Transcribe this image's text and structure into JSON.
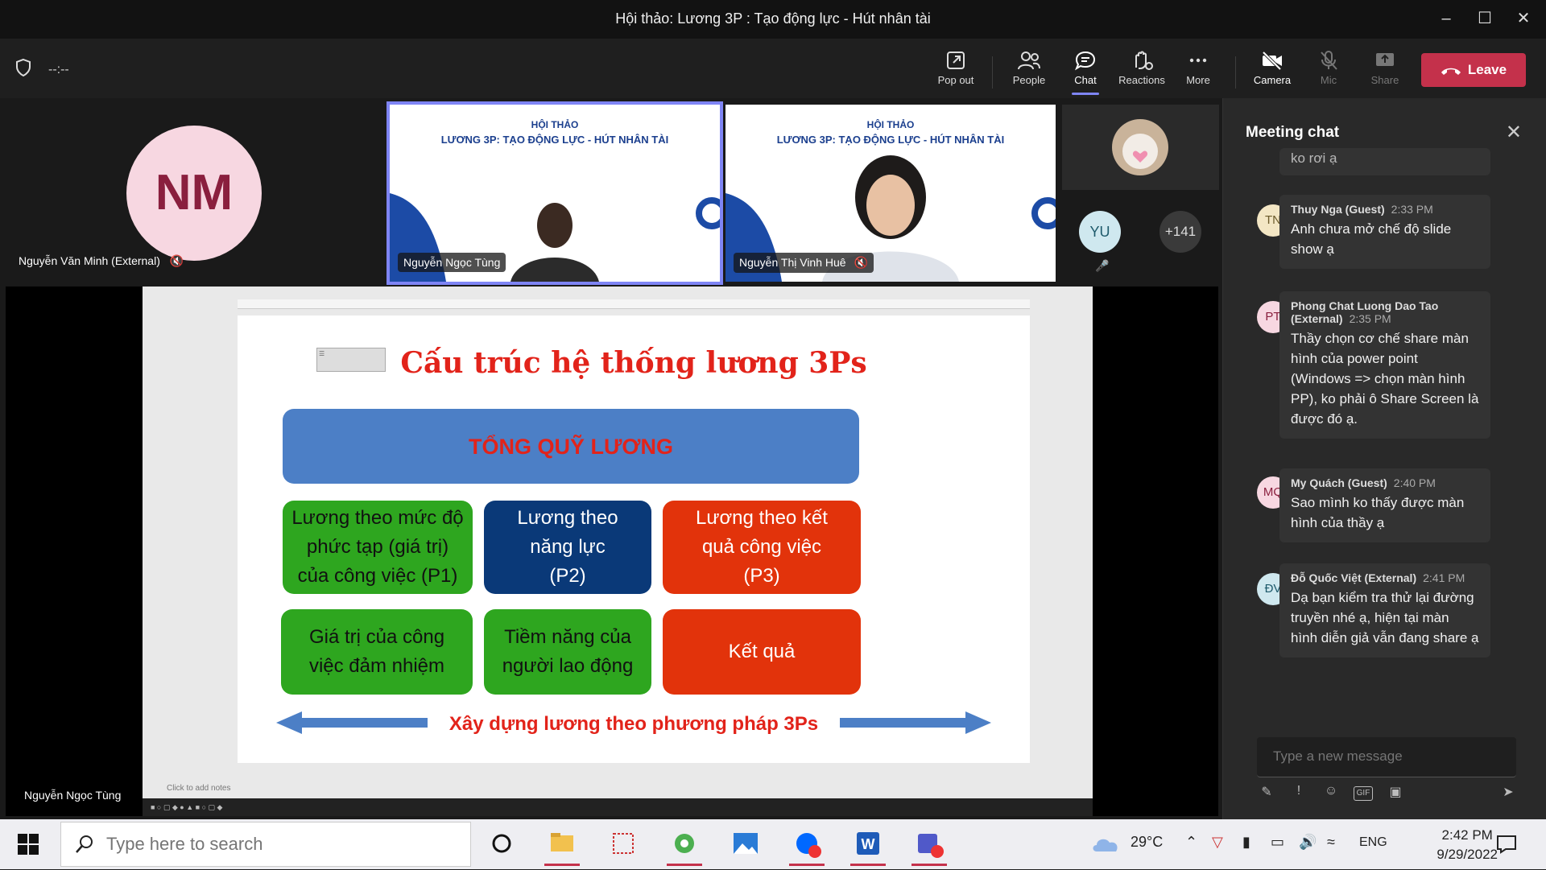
{
  "window": {
    "title": "Hội thảo: Lương 3P : Tạo động lực - Hút nhân tài"
  },
  "toolbar": {
    "timer": "--:--",
    "pop_out": "Pop out",
    "people": "People",
    "chat": "Chat",
    "reactions": "Reactions",
    "more": "More",
    "camera": "Camera",
    "mic": "Mic",
    "share": "Share",
    "leave": "Leave"
  },
  "participants": {
    "tile1": {
      "initials": "NM",
      "name": "Nguyễn Văn Minh (External)"
    },
    "tile2": {
      "name": "Nguyễn Ngọc Tùng",
      "slide_l1": "HỘI THẢO",
      "slide_l2": "LƯƠNG 3P: TẠO ĐỘNG LỰC - HÚT NHÂN TÀI"
    },
    "tile3": {
      "name": "Nguyễn Thị Vinh Huê",
      "slide_l1": "HỘI THẢO",
      "slide_l2": "LƯƠNG 3P: TẠO ĐỘNG LỰC - HÚT NHÂN TÀI"
    },
    "yu": "YU",
    "overflow": "+141"
  },
  "shared": {
    "presenter": "Nguyễn Ngọc Tùng",
    "title": "Cấu trúc hệ thống lương 3Ps",
    "top_box": "TỔNG QUỸ LƯƠNG",
    "p1": "Lương theo mức độ phức tạp (giá trị) của công việc (P1)",
    "p2": "Lương theo năng lực (P2)",
    "p3": "Lương theo kết quả công việc (P3)",
    "r1": "Giá trị của công việc đảm nhiệm",
    "r2": "Tiềm năng của người lao động",
    "r3": "Kết quả",
    "footer": "Xây dựng lương theo phương pháp 3Ps",
    "notes": "Click to add notes"
  },
  "chat": {
    "header": "Meeting chat",
    "partial": "ko rơi ạ",
    "messages": [
      {
        "initials": "TN",
        "author": "Thuy Nga (Guest)",
        "time": "2:33 PM",
        "text": "Anh chưa mở chế độ slide show ạ",
        "color": "#f3e6c4",
        "fg": "#6b5a2a"
      },
      {
        "initials": "PT",
        "author": "Phong Chat Luong Dao Tao (External)",
        "time": "2:35 PM",
        "text": "Thầy chọn cơ chế share màn hình của power point (Windows => chọn màn hình PP), ko phải ô Share Screen là được đó ạ.",
        "color": "#f7d7e1",
        "fg": "#8a1f3e"
      },
      {
        "initials": "MQ",
        "author": "My Quách (Guest)",
        "time": "2:40 PM",
        "text": "Sao mình ko thấy được màn hình của thầy ạ",
        "color": "#f7d7e1",
        "fg": "#8a1f3e"
      },
      {
        "initials": "ĐV",
        "author": "Đỗ Quốc Việt (External)",
        "time": "2:41 PM",
        "text": "Dạ bạn kiểm tra thử lại đường truyền nhé ạ, hiện tại màn hình diễn giả vẫn đang share ạ",
        "color": "#cfe8ef",
        "fg": "#1e5a6b"
      }
    ],
    "placeholder": "Type a new message"
  },
  "taskbar": {
    "search_placeholder": "Type here to search",
    "weather": "29°C",
    "lang": "ENG",
    "time": "2:42 PM",
    "date": "9/29/2022"
  }
}
